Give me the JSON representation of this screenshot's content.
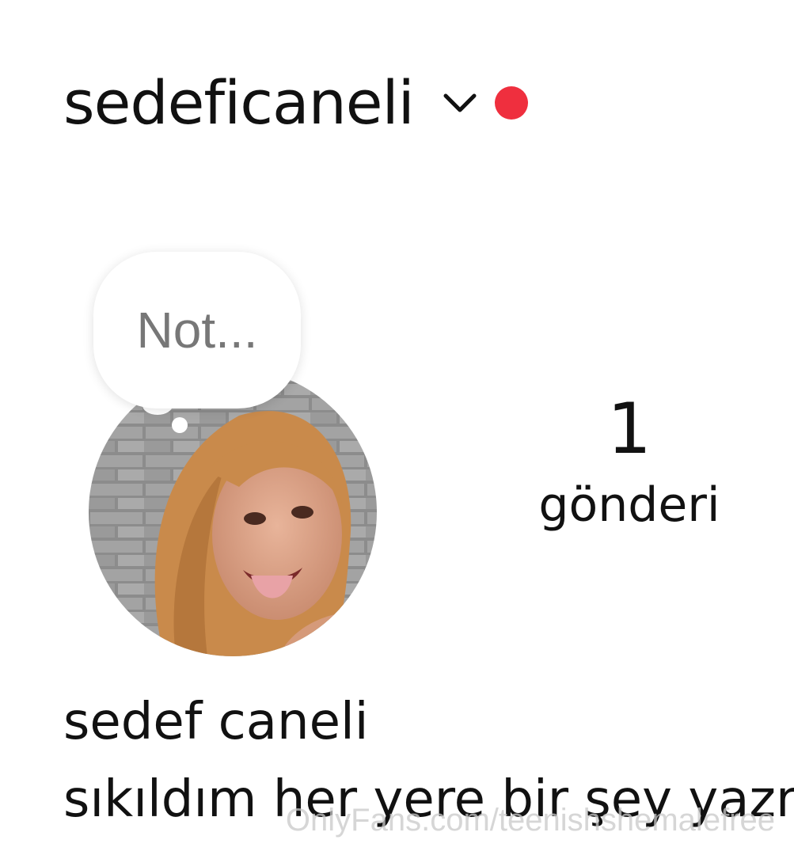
{
  "header": {
    "username": "sedeficaneli",
    "switch_icon": "chevron-down-icon",
    "notification_icon": "notification-dot-icon"
  },
  "note": {
    "placeholder": "Not..."
  },
  "stats": {
    "posts_count": "1",
    "posts_label": "gönderi"
  },
  "profile": {
    "display_name": "sedef caneli",
    "bio": "sıkıldım her yere bir şey yazm"
  },
  "watermark": {
    "text": "OnlyFans.com/teenishshemalefree"
  },
  "colors": {
    "notification_dot": "#ef2f3e",
    "text": "#111111",
    "note_text": "#777777"
  }
}
